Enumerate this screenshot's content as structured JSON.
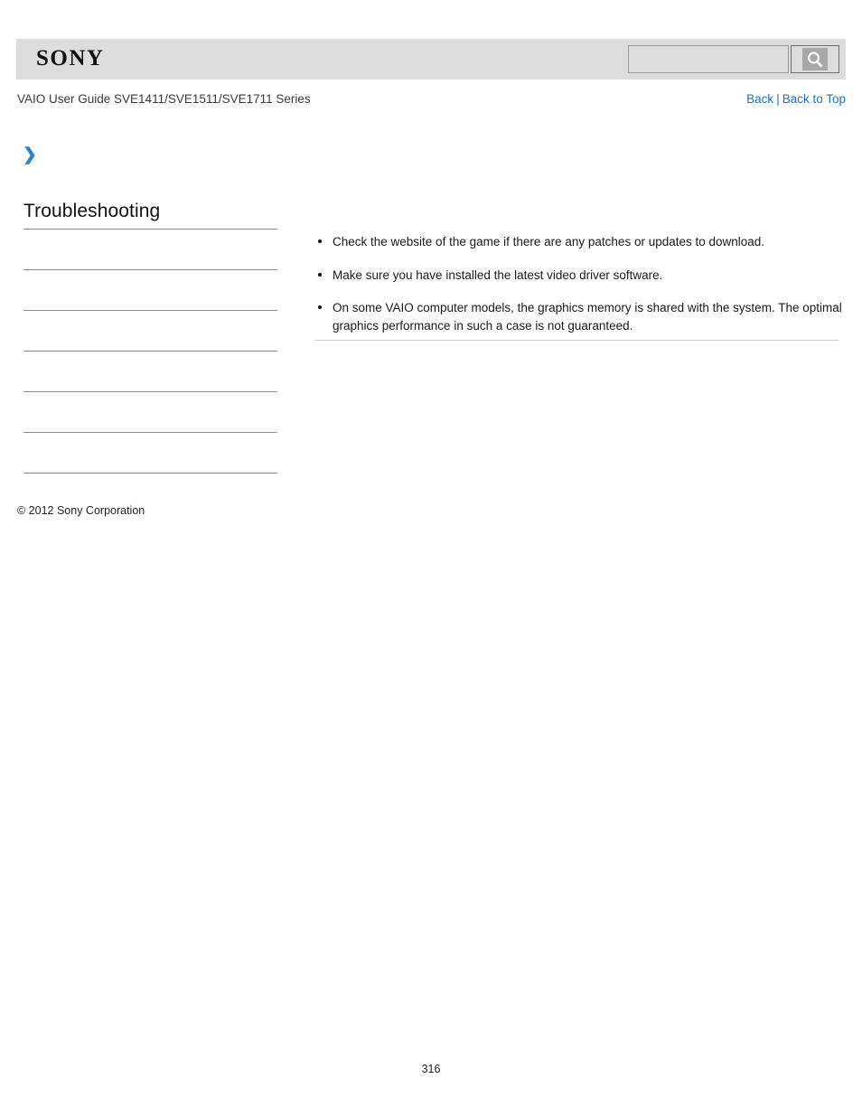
{
  "header": {
    "logo_text": "SONY",
    "search": {
      "value": "",
      "placeholder": "",
      "button_icon": "search-icon"
    }
  },
  "subheader": {
    "guide_title": "VAIO User Guide SVE1411/SVE1511/SVE1711 Series",
    "back_label": "Back",
    "separator": "|",
    "back_to_top_label": "Back to Top"
  },
  "breadcrumb": {
    "arrow_icon": "chevron-right-icon",
    "text": ""
  },
  "sidebar": {
    "title": "Troubleshooting",
    "items": [
      {
        "label": ""
      },
      {
        "label": ""
      },
      {
        "label": ""
      },
      {
        "label": ""
      },
      {
        "label": ""
      },
      {
        "label": ""
      }
    ]
  },
  "content": {
    "bullets": [
      "Check the website of the game if there are any patches or updates to download.",
      "Make sure you have installed the latest video driver software.",
      "On some VAIO computer models, the graphics memory is shared with the system. The optimal graphics performance in such a case is not guaranteed."
    ]
  },
  "footer": {
    "copyright": "© 2012 Sony Corporation",
    "page_number": "316"
  },
  "colors": {
    "header_bar": "#dcdcdc",
    "link_blue": "#1f6fc4",
    "chevron_blue": "#2b88c8",
    "rule_gray": "#8d8d8d",
    "content_rule_gray": "#cfcfcf"
  }
}
